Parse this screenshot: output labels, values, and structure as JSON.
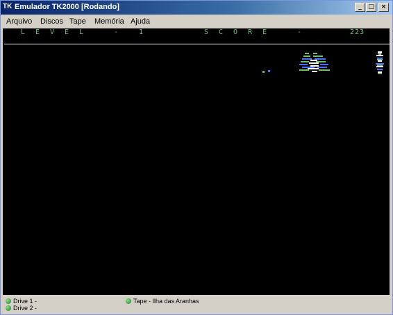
{
  "window": {
    "app_icon": "TK",
    "title": "Emulador TK2000 [Rodando]",
    "minimize_icon": "_",
    "maximize_icon": "□",
    "close_icon": "×"
  },
  "menu": [
    "Arquivo",
    "Discos",
    "Tape",
    "Memória",
    "Ajuda"
  ],
  "game": {
    "level_label": "LEVEL",
    "level_sep": "-",
    "level_value": "1",
    "score_label": "SCORE",
    "score_sep": "-",
    "score_value": "223"
  },
  "status": {
    "drive1": "Drive 1 -",
    "drive2": "Drive 2 -",
    "tape": "Tape - Ilha das Aranhas",
    "led_color": "#2e8b2e"
  },
  "colors": {
    "accent": "#0a246a",
    "hud": "#6dbd6d",
    "screen": "#000000"
  }
}
